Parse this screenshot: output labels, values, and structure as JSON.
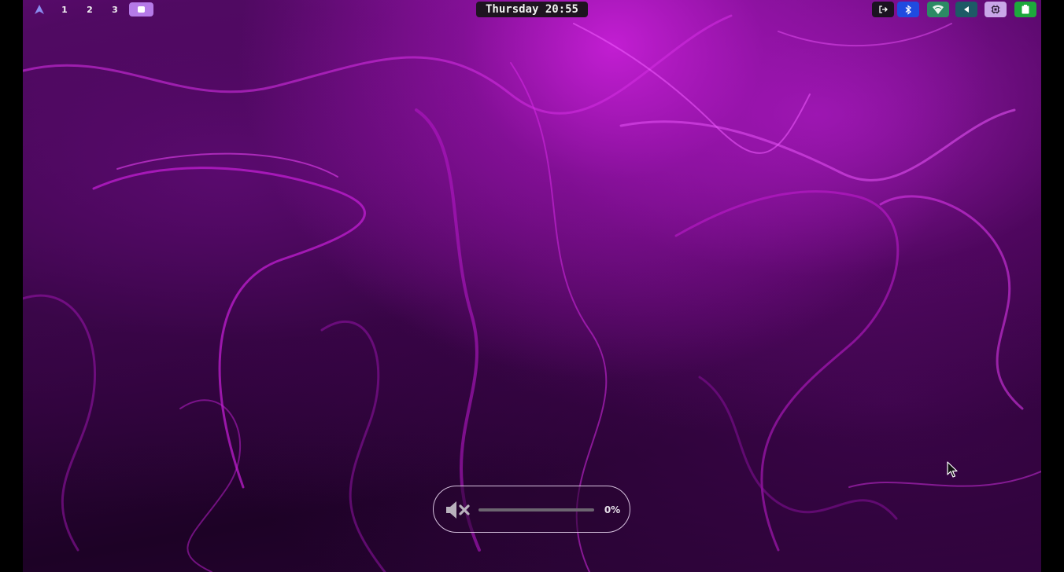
{
  "topbar": {
    "launcher_icon": "arch-linux-logo-icon",
    "workspaces": [
      "1",
      "2",
      "3"
    ],
    "active_workspace_icon": "active-workspace-square-icon",
    "clock": "Thursday 20:55",
    "tray": [
      {
        "icon": "logout-icon",
        "color": "#1b1320"
      },
      {
        "icon": "bluetooth-icon",
        "color": "#1f4be0"
      },
      {
        "icon": "wifi-icon",
        "color": "#2b8a64"
      },
      {
        "icon": "volume-muted-icon",
        "color": "#1d5a66"
      },
      {
        "icon": "cpu-icon",
        "color": "#c9a6e8"
      },
      {
        "icon": "battery-icon",
        "color": "#1da83c"
      }
    ]
  },
  "volume_osd": {
    "icon": "volume-muted-icon",
    "level": 0,
    "label": "0%"
  },
  "colors": {
    "accent": "#b57ae8",
    "wallpaper_primary": "#c21ed2",
    "wallpaper_dark": "#1d0226"
  }
}
